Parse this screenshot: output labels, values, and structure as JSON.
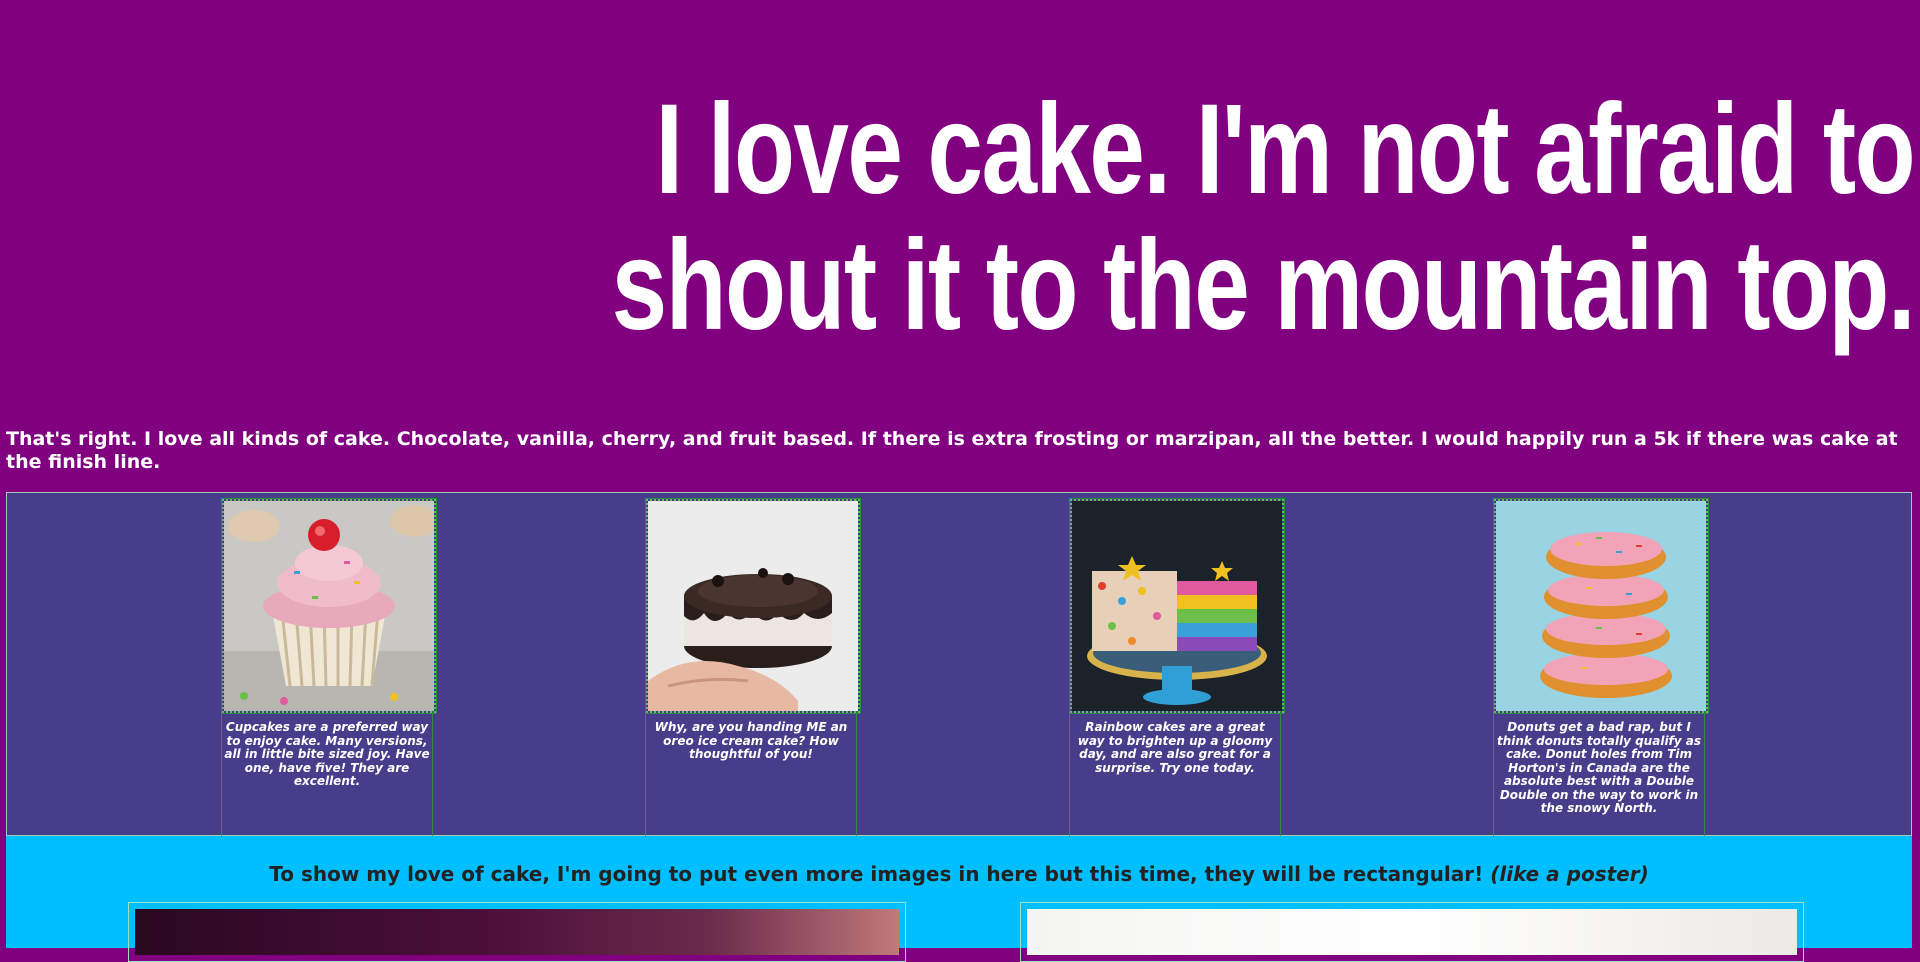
{
  "hero": {
    "title": "I love cake. I'm not afraid to shout it to the mountain top."
  },
  "intro": {
    "text": "That's right. I love all kinds of cake. Chocolate, vanilla, cherry, and fruit based. If there is extra frosting or marzipan, all the better. I would happily run a 5k if there was cake at the finish line."
  },
  "gallery": {
    "cards": [
      {
        "icon": "cupcake-photo",
        "caption": "Cupcakes are a preferred way to enjoy cake. Many versions, all in little bite sized joy. Have one, have five! They are excellent."
      },
      {
        "icon": "oreo-ice-cream-cake-photo",
        "caption": "Why, are you handing ME an oreo ice cream cake? How thoughtful of you!"
      },
      {
        "icon": "rainbow-cake-photo",
        "caption": "Rainbow cakes are a great way to brighten up a gloomy day, and are also great for a surprise. Try one today."
      },
      {
        "icon": "donut-stack-photo",
        "caption": "Donuts get a bad rap, but I think donuts totally qualify as cake. Donut holes from Tim Horton's in Canada are the absolute best with a Double Double on the way to work in the snowy North."
      }
    ]
  },
  "posters": {
    "heading": "To show my love of cake, I'm going to put even more images in here but this time, they will be rectangular!",
    "heading_em": "(like a poster)"
  },
  "colors": {
    "page_bg": "#800080",
    "gallery_bg": "#483d8b",
    "poster_bg": "#00bfff"
  }
}
